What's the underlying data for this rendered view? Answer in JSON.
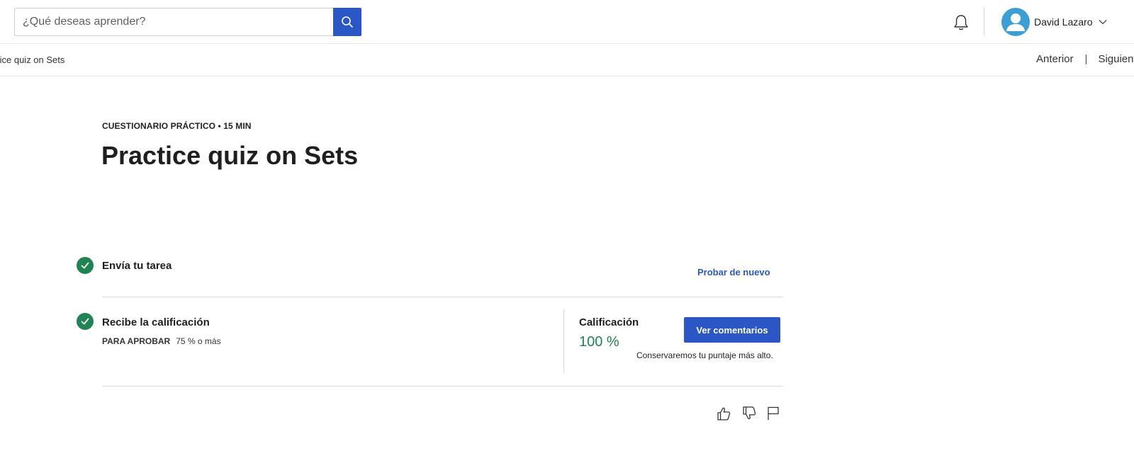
{
  "header": {
    "search": {
      "placeholder": "¿Qué deseas aprender?",
      "value": ""
    },
    "user": {
      "name": "David Lazaro"
    }
  },
  "subnav": {
    "breadcrumb": "tice quiz on Sets",
    "prev_label": "Anterior",
    "separator": "|",
    "next_label": "Siguient"
  },
  "quiz": {
    "kicker": "CUESTIONARIO PRÁCTICO • 15 MIN",
    "title": "Practice quiz on Sets"
  },
  "steps": [
    {
      "label": "Envía tu tarea",
      "action_label": "Probar de nuevo"
    },
    {
      "label": "Recibe la calificación",
      "pass_key": "PARA APROBAR",
      "pass_value": "75 % o más"
    }
  ],
  "grade": {
    "label": "Calificación",
    "value": "100 %",
    "button_label": "Ver comentarios",
    "note": "Conservaremos tu puntaje más alto."
  },
  "colors": {
    "accent": "#2a56c6",
    "success": "#1f8354",
    "avatar": "#3b9fd6"
  },
  "icons": [
    "search-icon",
    "bell-icon",
    "user-avatar-icon",
    "chevron-down-icon",
    "check-icon",
    "thumbs-up-icon",
    "thumbs-down-icon",
    "flag-icon"
  ]
}
